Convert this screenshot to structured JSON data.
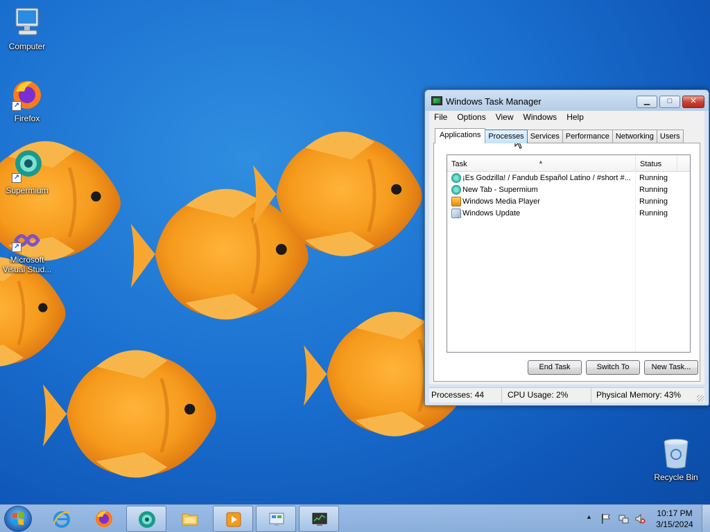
{
  "desktop": {
    "icons": [
      {
        "label": "Computer",
        "name": "computer"
      },
      {
        "label": "Firefox",
        "name": "firefox"
      },
      {
        "label": "Supermium",
        "name": "supermium"
      },
      {
        "label": "Microsoft Visual Stud...",
        "name": "visual-studio"
      },
      {
        "label": "Recycle Bin",
        "name": "recycle-bin"
      }
    ]
  },
  "taskmgr": {
    "title": "Windows Task Manager",
    "caption_buttons": {
      "minimize": "▁",
      "maximize": "□",
      "close": "✕"
    },
    "menu": [
      "File",
      "Options",
      "View",
      "Windows",
      "Help"
    ],
    "tabs": [
      "Applications",
      "Processes",
      "Services",
      "Performance",
      "Networking",
      "Users"
    ],
    "active_tab": "Applications",
    "hovered_tab": "Processes",
    "columns": {
      "task": "Task",
      "status": "Status"
    },
    "sort_indicator": "▲",
    "rows": [
      {
        "task": "¡Es Godzilla! / Fandub Español Latino / #short #...",
        "status": "Running",
        "icon": "supermium-icon"
      },
      {
        "task": "New Tab - Supermium",
        "status": "Running",
        "icon": "supermium-icon"
      },
      {
        "task": "Windows Media Player",
        "status": "Running",
        "icon": "media-player-icon"
      },
      {
        "task": "Windows Update",
        "status": "Running",
        "icon": "windows-update-icon"
      }
    ],
    "buttons": {
      "end_task": "End Task",
      "switch_to": "Switch To",
      "new_task": "New Task..."
    },
    "statusbar": {
      "processes": "Processes: 44",
      "cpu": "CPU Usage: 2%",
      "memory": "Physical Memory: 43%"
    }
  },
  "taskbar": {
    "items": [
      {
        "name": "internet-explorer",
        "icon": "ie-icon",
        "open": false
      },
      {
        "name": "firefox",
        "icon": "firefox-icon",
        "open": false
      },
      {
        "name": "supermium",
        "icon": "supermium-icon",
        "open": true
      },
      {
        "name": "windows-explorer",
        "icon": "folder-icon",
        "open": false
      },
      {
        "name": "windows-media-player",
        "icon": "media-player-icon",
        "open": true
      },
      {
        "name": "control-panel",
        "icon": "control-panel-icon",
        "open": true
      },
      {
        "name": "task-manager",
        "icon": "task-manager-icon",
        "open": true
      }
    ],
    "tray": {
      "show_hidden": "▲",
      "time": "10:17 PM",
      "date": "3/15/2024"
    }
  },
  "colors": {
    "wallpaper_blue": "#1a6fcf",
    "fish_orange": "#f59a1c",
    "window_frame": "#d6e4f3",
    "close_red": "#c6463a"
  }
}
